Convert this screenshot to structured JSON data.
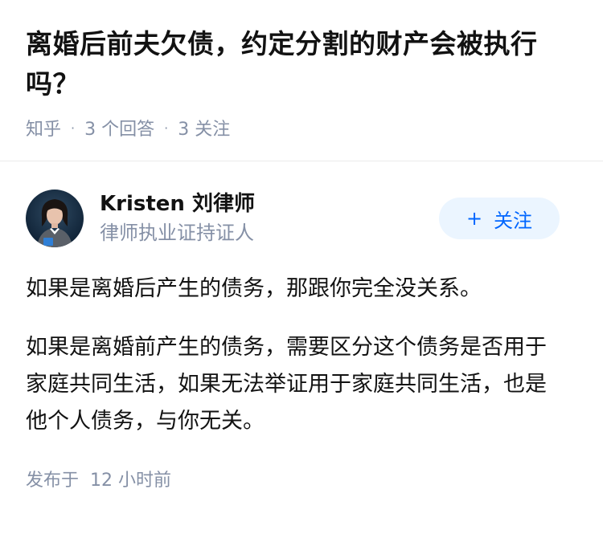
{
  "question": {
    "title": "离婚后前夫欠债，约定分割的财产会被执行吗？",
    "source": "知乎",
    "answers_count": "3",
    "answers_label": "个回答",
    "followers_count": "3",
    "followers_label": "关注"
  },
  "answer": {
    "author_name": "Kristen 刘律师",
    "author_desc": "律师执业证持证人",
    "follow_plus": "+",
    "follow_label": "关注",
    "paragraphs": [
      "如果是离婚后产生的债务，那跟你完全没关系。",
      "如果是离婚前产生的债务，需要区分这个债务是否用于家庭共同生活，如果无法举证用于家庭共同生活，也是他个人债务，与你无关。"
    ],
    "publish_label": "发布于",
    "publish_time": "12 小时前"
  },
  "colors": {
    "title": "#121212",
    "meta": "#8590a6",
    "accent": "#0066ff",
    "follow_bg": "#ebf5ff"
  },
  "icons": {
    "avatar": "author-avatar"
  }
}
